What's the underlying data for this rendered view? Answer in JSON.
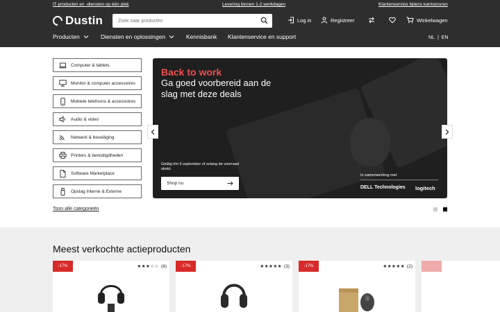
{
  "topbar": {
    "link1": "IT-producten en -diensten op één plek",
    "link2": "Levering binnen 1-2 werkdagen",
    "link3": "Klantenservice tijdens kantooruren"
  },
  "header": {
    "logo": "Dustin",
    "search_placeholder": "Zoek naar producten",
    "login": "Log in",
    "register": "Registreer",
    "cart": "Winkelwagen"
  },
  "nav": {
    "products": "Producten",
    "services": "Diensten en oplossingen",
    "knowledge": "Kennisbank",
    "support": "Klantenservice en support",
    "lang_nl": "NL",
    "lang_sep": "|",
    "lang_en": "EN"
  },
  "categories": [
    {
      "label": "Computer & tablets",
      "icon": "laptop-icon"
    },
    {
      "label": "Monitor & computer accessoires",
      "icon": "monitor-icon"
    },
    {
      "label": "Mobiele telefoons & accessoires",
      "icon": "phone-icon"
    },
    {
      "label": "Audio & video",
      "icon": "speaker-icon"
    },
    {
      "label": "Netwerk & beveiliging",
      "icon": "wifi-icon"
    },
    {
      "label": "Printers & benodigdheden",
      "icon": "printer-icon"
    },
    {
      "label": "Software Marketplace",
      "icon": "document-icon"
    },
    {
      "label": "Opslag Interne & Externe",
      "icon": "usb-icon"
    }
  ],
  "show_all": "Toon alle categorieën",
  "hero": {
    "headline": "Back to work",
    "subheadline": "Ga goed voorbereid aan de slag met deze deals",
    "note": "Geldig t/m 6 september of zolang de voorraad strekt.",
    "cta": "Shop nu",
    "partner_text": "In samenwerking met",
    "partner1": "DELL Technologies",
    "partner2": "logitech",
    "accent": "#f04e4e"
  },
  "bestsellers": {
    "title": "Meest verkochte actieproducten",
    "products": [
      {
        "badge": "-17%",
        "stars": "★★★☆☆",
        "count": "(6)",
        "rating": 3
      },
      {
        "badge": "-17%",
        "stars": "★★★★★",
        "count": "(3)",
        "rating": 5
      },
      {
        "badge": "-17%",
        "stars": "★★★★★",
        "count": "(2)",
        "rating": 5
      }
    ]
  }
}
